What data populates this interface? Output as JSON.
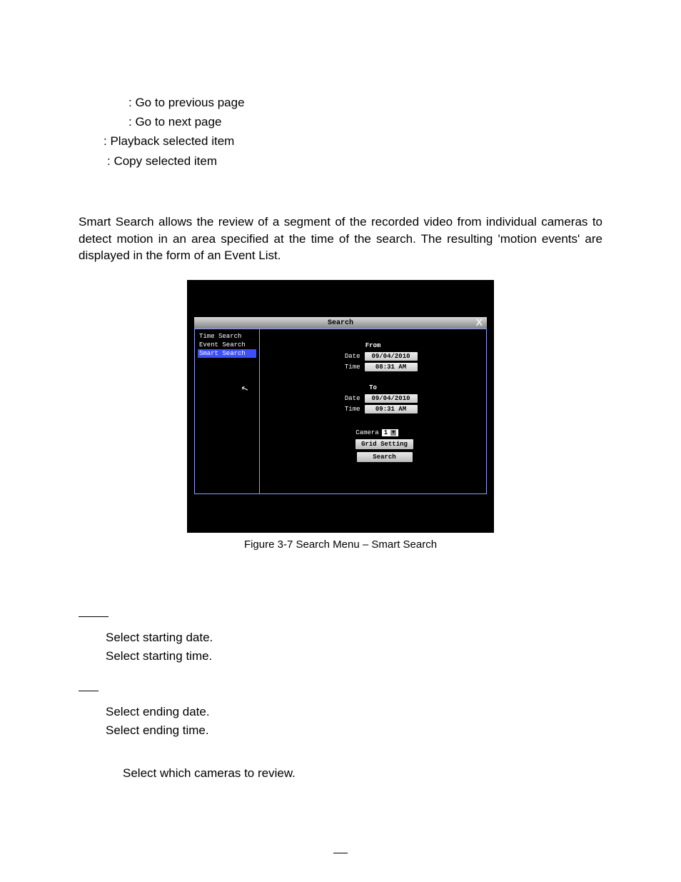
{
  "glossary": {
    "prev_page": ": Go to previous page",
    "next_page": ": Go to next page",
    "playback": ": Playback selected item",
    "copy": ": Copy selected item"
  },
  "paragraph": "Smart Search allows the review of a segment of the recorded video from individual cameras to detect motion in an area specified at the time of the search. The resulting 'motion events' are displayed in the form of an Event List.",
  "screenshot": {
    "title": "Search",
    "close": "X",
    "sidebar": {
      "items": [
        "Time Search",
        "Event Search",
        "Smart Search"
      ],
      "selected_index": 2
    },
    "from": {
      "header": "From",
      "date_label": "Date",
      "date_value": "09/04/2010",
      "time_label": "Time",
      "time_value": "08:31 AM"
    },
    "to": {
      "header": "To",
      "date_label": "Date",
      "date_value": "09/04/2010",
      "time_label": "Time",
      "time_value": "09:31 AM"
    },
    "camera": {
      "label": "Camera",
      "value": "1"
    },
    "buttons": {
      "grid": "Grid Setting",
      "search": "Search"
    }
  },
  "figure_caption": "Figure 3-7 Search Menu – Smart Search",
  "definitions": {
    "from_date": "Select starting date.",
    "from_time": "Select starting time.",
    "to_date": "Select ending date.",
    "to_time": "Select ending time.",
    "camera": "Select which cameras to review."
  }
}
